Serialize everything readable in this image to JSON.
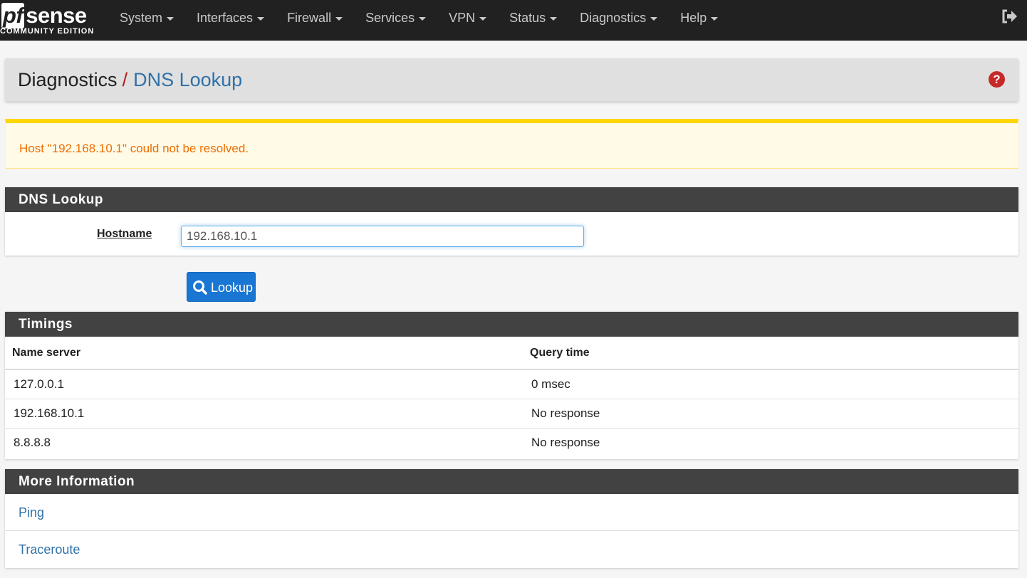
{
  "navbar": {
    "logo_main_pf": "pf",
    "logo_main_rest": "sense",
    "logo_sub": "COMMUNITY EDITION",
    "menu": [
      {
        "label": "System"
      },
      {
        "label": "Interfaces"
      },
      {
        "label": "Firewall"
      },
      {
        "label": "Services"
      },
      {
        "label": "VPN"
      },
      {
        "label": "Status"
      },
      {
        "label": "Diagnostics"
      },
      {
        "label": "Help"
      }
    ],
    "logout_icon": "sign-out-icon"
  },
  "header": {
    "parent": "Diagnostics",
    "separator": "/",
    "current": "DNS Lookup",
    "help_glyph": "?"
  },
  "alert": {
    "message": "Host \"192.168.10.1\" could not be resolved.",
    "color": "#ef6c00"
  },
  "dns_panel": {
    "title": "DNS Lookup",
    "hostname_label": "Hostname",
    "hostname_value": "192.168.10.1"
  },
  "lookup_button": {
    "label": "Lookup",
    "icon": "search-icon",
    "color": "#1976d2"
  },
  "timings": {
    "title": "Timings",
    "columns": [
      "Name server",
      "Query time"
    ],
    "rows": [
      [
        "127.0.0.1",
        "0 msec"
      ],
      [
        "192.168.10.1",
        "No response"
      ],
      [
        "8.8.8.8",
        "No response"
      ]
    ]
  },
  "more_info": {
    "title": "More Information",
    "links": [
      "Ping",
      "Traceroute"
    ]
  }
}
